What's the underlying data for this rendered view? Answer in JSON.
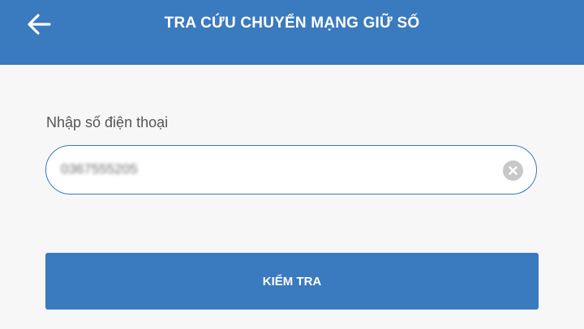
{
  "header": {
    "title": "TRA CỨU CHUYỂN MẠNG GIỮ SỐ",
    "back_icon": "arrow-left-icon"
  },
  "form": {
    "label": "Nhập số điện thoại",
    "phone_value": "0367555205",
    "clear_icon": "clear-circle-icon",
    "submit_label": "KIỂM TRA"
  },
  "colors": {
    "primary": "#3a7abf",
    "background": "#f7f7f7",
    "clear_icon": "#c8c8c8"
  }
}
